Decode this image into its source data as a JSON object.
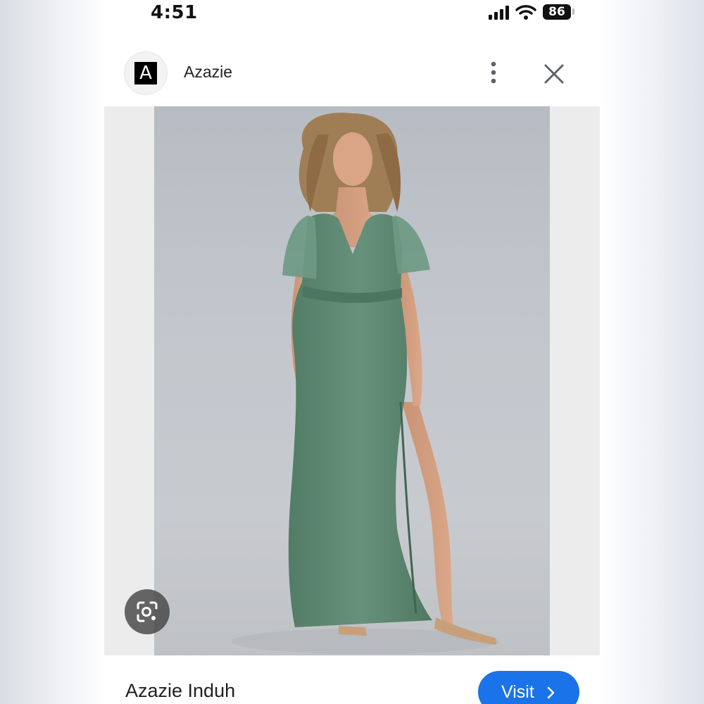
{
  "status_bar": {
    "time": "4:51",
    "battery": "86",
    "icons": [
      "signal-icon",
      "wifi-icon",
      "battery-icon"
    ]
  },
  "header": {
    "site_logo_letter": "A",
    "site_name": "Azazie",
    "icons": [
      "more-vertical-icon",
      "close-icon"
    ]
  },
  "image": {
    "subject": "model wearing sage green flutter-sleeve maxi dress with slit",
    "dress_color": "#5f8b73",
    "background_color": "#c4c7cc"
  },
  "lens": {
    "icon": "lens-search-icon"
  },
  "footer": {
    "title": "Azazie Induh",
    "visit_label": "Visit",
    "visit_color": "#1a73e8"
  }
}
